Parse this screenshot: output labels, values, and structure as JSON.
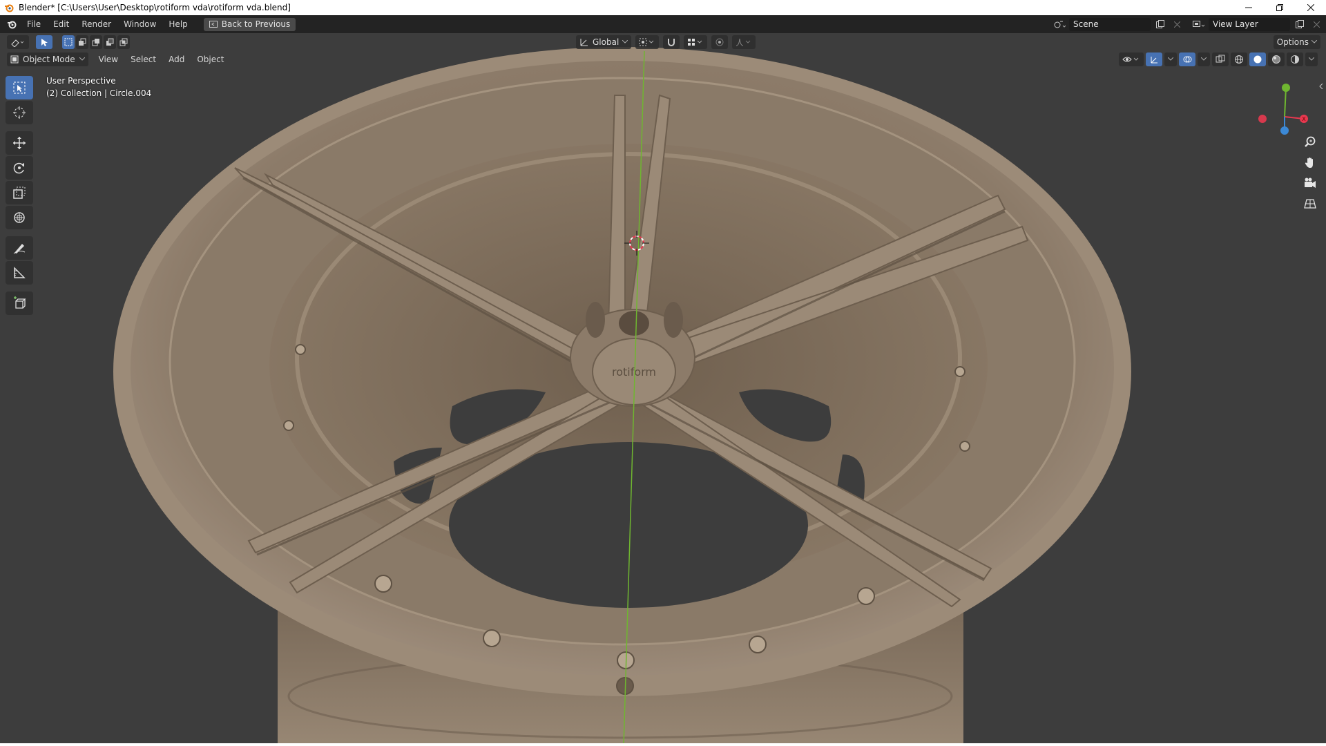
{
  "window": {
    "title": "Blender* [C:\\Users\\User\\Desktop\\rotiform vda\\rotiform vda.blend]",
    "minimize_icon": "minimize-icon",
    "maximize_icon": "restore-icon",
    "close_icon": "close-icon"
  },
  "topbar": {
    "menus": [
      "File",
      "Edit",
      "Render",
      "Window",
      "Help"
    ],
    "back_button": "Back to Previous",
    "scene_name": "Scene",
    "view_layer": "View Layer"
  },
  "viewport_header": {
    "orientation": "Global",
    "options_label": "Options"
  },
  "mode_bar": {
    "mode": "Object Mode",
    "menus": [
      "View",
      "Select",
      "Add",
      "Object"
    ]
  },
  "overlay": {
    "perspective": "User Perspective",
    "collection": "(2) Collection | Circle.004"
  },
  "model": {
    "hub_logo_text": "rotiform",
    "material_color": "#8a7a68",
    "background_color": "#3d3d3d"
  },
  "colors": {
    "accent": "#4772b3",
    "axis_x": "#e8384f",
    "axis_y": "#6fb630",
    "axis_z": "#3c89d6"
  },
  "toolbar": [
    "select-box-icon",
    "cursor-icon",
    "move-icon",
    "rotate-icon",
    "scale-icon",
    "transform-icon",
    "annotate-icon",
    "measure-icon",
    "add-cube-icon"
  ],
  "nav_buttons": [
    "zoom-icon",
    "pan-hand-icon",
    "camera-icon",
    "grid-ortho-icon"
  ]
}
